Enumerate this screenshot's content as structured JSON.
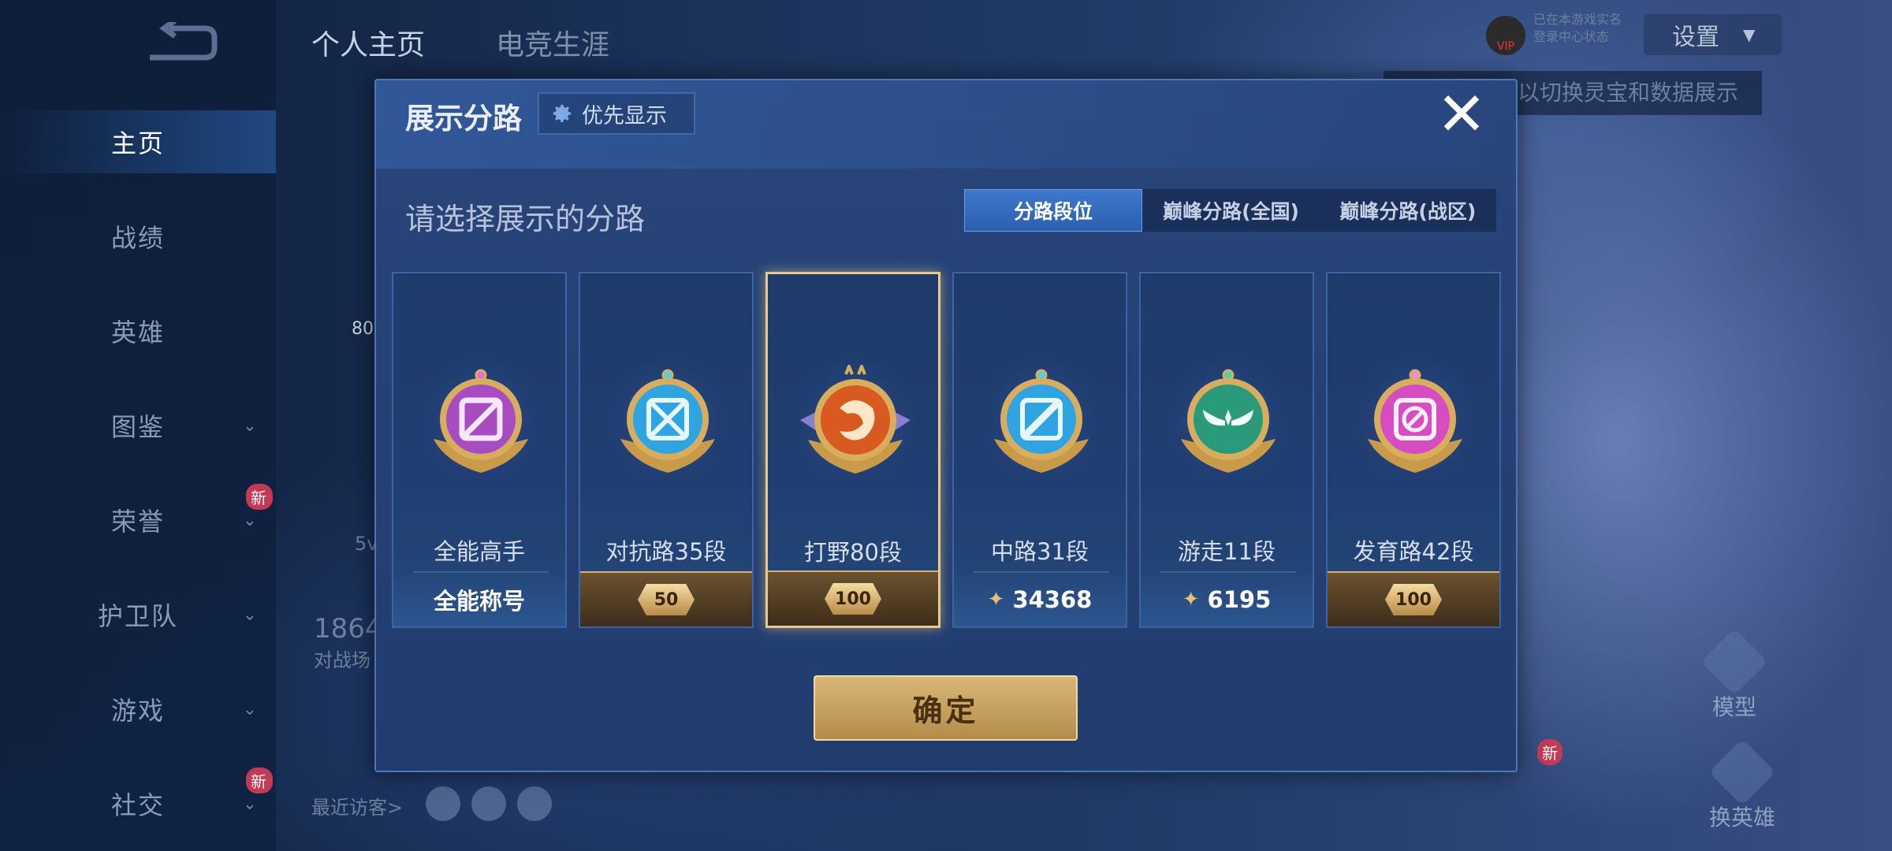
{
  "sidebar": {
    "items": [
      {
        "label": "主页",
        "active": true
      },
      {
        "label": "战绩"
      },
      {
        "label": "英雄"
      },
      {
        "label": "图鉴",
        "chevron": true
      },
      {
        "label": "荣誉",
        "chevron": true,
        "badge": "新"
      },
      {
        "label": "护卫队",
        "chevron": true
      },
      {
        "label": "游戏",
        "chevron": true
      },
      {
        "label": "社交",
        "chevron": true,
        "badge": "新"
      }
    ]
  },
  "top_tabs": [
    "个人主页",
    "电竞生涯"
  ],
  "settings_label": "设置",
  "vip_label": "VIP",
  "vip_lines": [
    "已在本游戏实名",
    "登录中心状态"
  ],
  "hint_text": "以切换灵宝和数据展示",
  "background": {
    "stat_number": "1864",
    "stat_label": "对战场",
    "level_text": "80",
    "fivev_text": "5v",
    "visitor_label": "最近访客>"
  },
  "right_buttons": {
    "model": "模型",
    "switch_hero": "换英雄",
    "new_badge": "新"
  },
  "modal": {
    "title": "展示分路",
    "priority_label": "优先显示",
    "close_symbol": "✕",
    "prompt": "请选择展示的分路",
    "segments": [
      {
        "label": "分路段位",
        "active": true
      },
      {
        "label": "巅峰分路(全国)"
      },
      {
        "label": "巅峰分路(战区)"
      }
    ],
    "cards": [
      {
        "name": "全能高手",
        "footer": "全能称号",
        "footer_type": "text",
        "emblem_color": "#a84cc2",
        "emblem_icon": "slash-square-icon"
      },
      {
        "name": "对抗路35段",
        "footer": "50",
        "footer_type": "level",
        "emblem_color": "#2fa4e0",
        "emblem_icon": "crossed-swords-icon"
      },
      {
        "name": "打野80段",
        "footer": "100",
        "footer_type": "level",
        "emblem_color": "#d85a20",
        "emblem_icon": "dragon-icon",
        "selected": true
      },
      {
        "name": "中路31段",
        "footer": "34368",
        "footer_type": "stat",
        "emblem_color": "#2fa4e0",
        "emblem_icon": "wand-icon"
      },
      {
        "name": "游走11段",
        "footer": "6195",
        "footer_type": "stat",
        "emblem_color": "#2a9a7a",
        "emblem_icon": "wings-icon"
      },
      {
        "name": "发育路42段",
        "footer": "100",
        "footer_type": "level",
        "emblem_color": "#d84cc2",
        "emblem_icon": "no-symbol-icon"
      }
    ],
    "confirm_label": "确定"
  }
}
